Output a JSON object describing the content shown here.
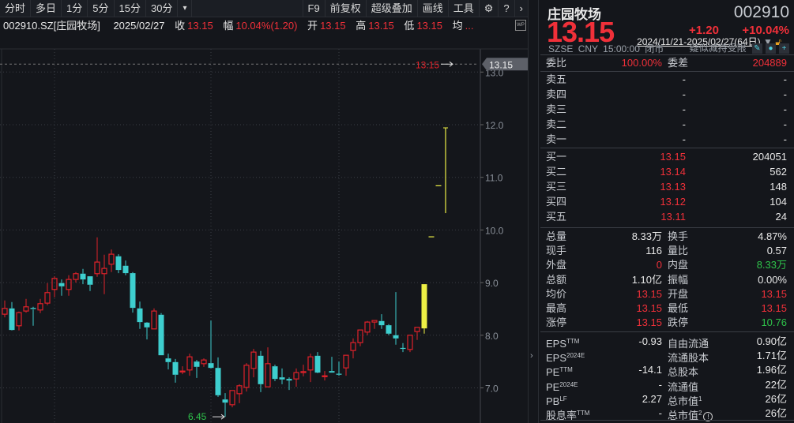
{
  "toolbar": {
    "items": [
      "分时",
      "多日",
      "1分",
      "5分",
      "15分",
      "30分"
    ],
    "more": "▾",
    "right_items": [
      "F9",
      "前复权",
      "超级叠加",
      "画线",
      "工具"
    ]
  },
  "info": {
    "code": "002910.SZ[庄园牧场]",
    "date": "2025/02/27",
    "close_label": "收",
    "close": "13.15",
    "chg_label": "幅",
    "chg": "10.04%(1.20)",
    "open_label": "开",
    "open": "13.15",
    "high_label": "高",
    "high": "13.15",
    "low_label": "低",
    "low": "13.15",
    "avg_label": "均",
    "avg": "..."
  },
  "range": "2024/11/21-2025/02/27(64日)",
  "chart": {
    "last_price_label": "13.15",
    "axis_tag": "13.15",
    "low_label": "6.45",
    "yticks": [
      "13.0",
      "12.0",
      "11.0",
      "10.0",
      "9.0",
      "8.0",
      "7.0"
    ],
    "colors": {
      "up": "#e0222a",
      "down": "#3ecfcf",
      "limit": "#eef045"
    }
  },
  "chart_data": {
    "type": "candlestick",
    "ylim": [
      6.3,
      13.3
    ],
    "yticks": [
      7,
      8,
      9,
      10,
      11,
      12,
      13
    ],
    "range": "2024/11/21-2025/02/27",
    "candles": [
      [
        8.4,
        8.66,
        8.34,
        8.51,
        "u"
      ],
      [
        8.51,
        8.63,
        8.09,
        8.1,
        "d"
      ],
      [
        8.18,
        8.45,
        8.09,
        8.43,
        "u"
      ],
      [
        8.46,
        8.69,
        8.43,
        8.54,
        "u"
      ],
      [
        8.51,
        8.54,
        8.18,
        8.49,
        "d"
      ],
      [
        8.48,
        8.69,
        8.42,
        8.6,
        "u"
      ],
      [
        8.61,
        8.99,
        8.57,
        8.81,
        "u"
      ],
      [
        8.87,
        9.12,
        8.72,
        9.08,
        "u"
      ],
      [
        8.99,
        9.06,
        8.75,
        8.93,
        "d"
      ],
      [
        8.87,
        9.14,
        8.75,
        9.06,
        "u"
      ],
      [
        9.06,
        9.2,
        9.0,
        9.17,
        "u"
      ],
      [
        9.17,
        9.26,
        8.97,
        9.06,
        "d"
      ],
      [
        9.12,
        9.12,
        8.84,
        8.96,
        "d"
      ],
      [
        9.17,
        9.86,
        9.11,
        9.39,
        "u"
      ],
      [
        9.17,
        9.53,
        8.78,
        9.27,
        "u"
      ],
      [
        9.35,
        9.63,
        9.2,
        9.54,
        "u"
      ],
      [
        9.5,
        9.54,
        9.18,
        9.24,
        "d"
      ],
      [
        9.32,
        9.42,
        9.14,
        9.18,
        "d"
      ],
      [
        9.18,
        9.2,
        8.43,
        8.52,
        "d"
      ],
      [
        8.51,
        8.64,
        8.12,
        8.25,
        "d"
      ],
      [
        8.24,
        8.25,
        7.92,
        8.15,
        "d"
      ],
      [
        8.12,
        8.51,
        8.12,
        8.46,
        "u"
      ],
      [
        8.39,
        8.42,
        7.62,
        7.62,
        "d"
      ],
      [
        7.56,
        7.65,
        7.35,
        7.49,
        "d"
      ],
      [
        7.49,
        7.55,
        7.1,
        7.25,
        "d"
      ],
      [
        7.31,
        7.41,
        7.26,
        7.32,
        "u"
      ],
      [
        7.34,
        7.65,
        7.23,
        7.59,
        "u"
      ],
      [
        7.5,
        7.53,
        7.19,
        7.4,
        "d"
      ],
      [
        7.46,
        7.56,
        7.4,
        7.53,
        "u"
      ],
      [
        7.47,
        8.28,
        7.37,
        7.38,
        "d"
      ],
      [
        7.38,
        7.58,
        6.83,
        6.86,
        "d"
      ],
      [
        6.78,
        6.9,
        6.45,
        6.72,
        "d"
      ],
      [
        6.68,
        6.95,
        6.63,
        6.95,
        "u"
      ],
      [
        6.89,
        7.07,
        6.71,
        7.04,
        "u"
      ],
      [
        7.01,
        7.47,
        6.93,
        7.43,
        "u"
      ],
      [
        7.37,
        7.74,
        7.2,
        7.68,
        "u"
      ],
      [
        7.61,
        7.7,
        6.92,
        7.07,
        "d"
      ],
      [
        7.02,
        7.77,
        7.02,
        7.46,
        "u"
      ],
      [
        7.41,
        7.44,
        7.13,
        7.17,
        "d"
      ],
      [
        7.2,
        7.37,
        7.07,
        7.16,
        "d"
      ],
      [
        7.17,
        7.2,
        6.96,
        7.14,
        "d"
      ],
      [
        7.17,
        7.37,
        7.02,
        7.29,
        "u"
      ],
      [
        7.29,
        7.44,
        7.22,
        7.31,
        "u"
      ],
      [
        7.34,
        7.65,
        7.11,
        7.59,
        "u"
      ],
      [
        7.61,
        7.68,
        7.28,
        7.29,
        "d"
      ],
      [
        7.23,
        7.32,
        7.14,
        7.23,
        "u"
      ],
      [
        7.32,
        7.59,
        7.29,
        7.29,
        "d"
      ],
      [
        7.26,
        7.5,
        7.23,
        7.25,
        "d"
      ],
      [
        7.38,
        7.62,
        7.23,
        7.62,
        "u"
      ],
      [
        7.71,
        7.94,
        7.56,
        7.86,
        "u"
      ],
      [
        7.86,
        8.1,
        7.79,
        8.1,
        "u"
      ],
      [
        8.06,
        8.27,
        8.0,
        8.25,
        "u"
      ],
      [
        8.25,
        8.28,
        8.12,
        8.28,
        "u"
      ],
      [
        8.27,
        8.4,
        8.12,
        8.19,
        "d"
      ],
      [
        8.19,
        8.21,
        8.0,
        8.03,
        "d"
      ],
      [
        8.0,
        8.82,
        7.82,
        7.94,
        "d"
      ],
      [
        7.75,
        7.85,
        7.68,
        7.74,
        "d"
      ],
      [
        7.73,
        8.0,
        7.68,
        8.0,
        "u"
      ],
      [
        8.07,
        8.15,
        7.91,
        8.15,
        "u"
      ],
      [
        8.13,
        8.97,
        8.03,
        8.97,
        "y"
      ],
      [
        9.87,
        9.87,
        9.87,
        9.87,
        "y"
      ],
      [
        10.84,
        10.84,
        10.84,
        10.84,
        "y"
      ],
      [
        10.32,
        11.94,
        10.32,
        11.94,
        "yl"
      ]
    ]
  },
  "quote": {
    "name": "庄园牧场",
    "code": "002910",
    "price": "13.15",
    "change": "+1.20",
    "change_pct": "+10.04%",
    "exchange": "SZSE",
    "currency": "CNY",
    "time": "15:00:00",
    "status": "闭市",
    "warning": "疑似减持受限"
  },
  "weibi": {
    "label": "委比",
    "value": "100.00%",
    "label2": "委差",
    "value2": "204889"
  },
  "sell": [
    {
      "label": "卖五",
      "price": "-",
      "vol": "-"
    },
    {
      "label": "卖四",
      "price": "-",
      "vol": "-"
    },
    {
      "label": "卖三",
      "price": "-",
      "vol": "-"
    },
    {
      "label": "卖二",
      "price": "-",
      "vol": "-"
    },
    {
      "label": "卖一",
      "price": "-",
      "vol": "-"
    }
  ],
  "buy": [
    {
      "label": "买一",
      "price": "13.15",
      "vol": "204051"
    },
    {
      "label": "买二",
      "price": "13.14",
      "vol": "562"
    },
    {
      "label": "买三",
      "price": "13.13",
      "vol": "148"
    },
    {
      "label": "买四",
      "price": "13.12",
      "vol": "104"
    },
    {
      "label": "买五",
      "price": "13.11",
      "vol": "24"
    }
  ],
  "stats": [
    {
      "l1": "总量",
      "v1": "8.33万",
      "c1": "white",
      "l2": "换手",
      "v2": "4.87%",
      "c2": "white"
    },
    {
      "l1": "现手",
      "v1": "116",
      "c1": "white",
      "l2": "量比",
      "v2": "0.57",
      "c2": "white"
    },
    {
      "l1": "外盘",
      "v1": "0",
      "c1": "red",
      "l2": "内盘",
      "v2": "8.33万",
      "c2": "green"
    },
    {
      "l1": "总额",
      "v1": "1.10亿",
      "c1": "white",
      "l2": "振幅",
      "v2": "0.00%",
      "c2": "white"
    },
    {
      "l1": "均价",
      "v1": "13.15",
      "c1": "red",
      "l2": "开盘",
      "v2": "13.15",
      "c2": "red"
    },
    {
      "l1": "最高",
      "v1": "13.15",
      "c1": "red",
      "l2": "最低",
      "v2": "13.15",
      "c2": "red"
    },
    {
      "l1": "涨停",
      "v1": "13.15",
      "c1": "red",
      "l2": "跌停",
      "v2": "10.76",
      "c2": "green"
    }
  ],
  "fund": [
    {
      "l1": "EPS",
      "s1": "TTM",
      "v1": "-0.93",
      "l2": "自由流通",
      "s2": "",
      "v2": "0.90亿"
    },
    {
      "l1": "EPS",
      "s1": "2024E",
      "v1": "",
      "l2": "流通股本",
      "s2": "",
      "v2": "1.71亿"
    },
    {
      "l1": "PE",
      "s1": "TTM",
      "v1": "-14.1",
      "l2": "总股本",
      "s2": "",
      "v2": "1.96亿"
    },
    {
      "l1": "PE",
      "s1": "2024E",
      "v1": "-",
      "l2": "流通值",
      "s2": "",
      "v2": "22亿"
    },
    {
      "l1": "PB",
      "s1": "LF",
      "v1": "2.27",
      "l2": "总市值",
      "s2": "1",
      "v2": "26亿"
    },
    {
      "l1": "股息率",
      "s1": "TTM",
      "v1": "-",
      "l2": "总市值",
      "s2": "2",
      "v2": "26亿"
    }
  ]
}
